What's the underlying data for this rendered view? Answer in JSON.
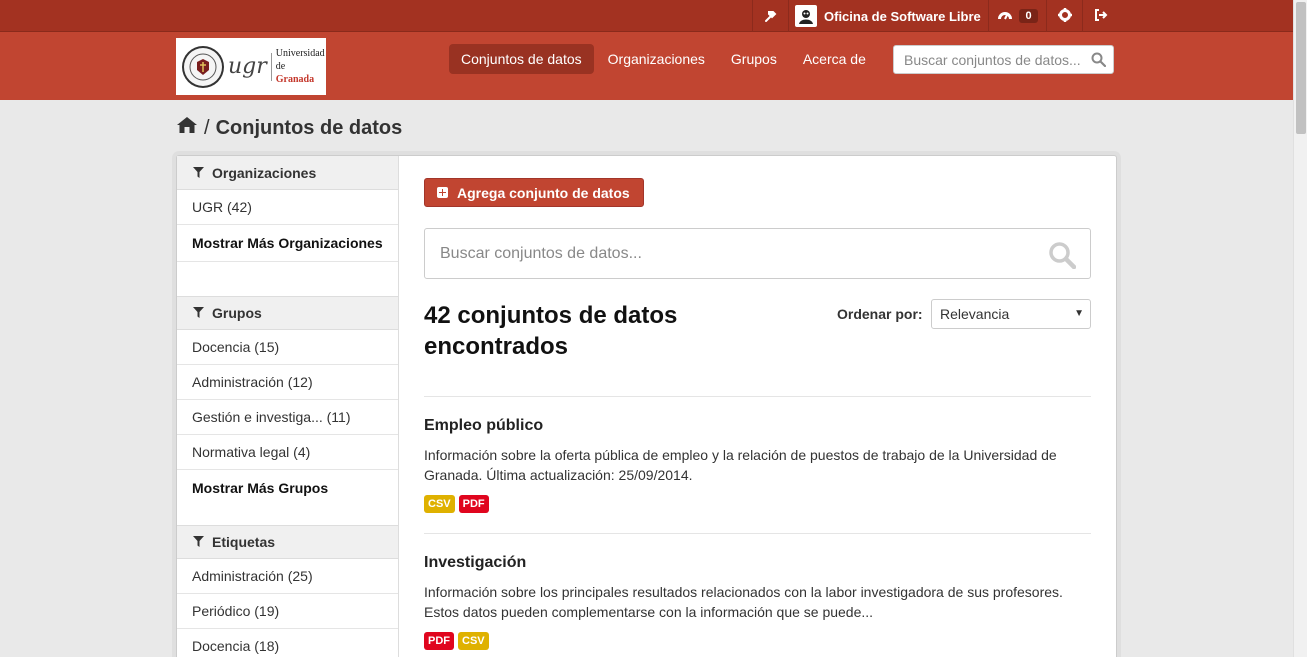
{
  "account": {
    "org_name": "Oficina de Software Libre",
    "activity_count": "0"
  },
  "brand": {
    "logo_abbr": "ugr",
    "logo_line1": "Universidad",
    "logo_line2_prefix": "de ",
    "logo_line2_accent": "Granada"
  },
  "nav": {
    "items": [
      {
        "label": "Conjuntos de datos",
        "active": true
      },
      {
        "label": "Organizaciones"
      },
      {
        "label": "Grupos"
      },
      {
        "label": "Acerca de"
      }
    ]
  },
  "header_search": {
    "placeholder": "Buscar conjuntos de datos..."
  },
  "breadcrumb": {
    "separator": "/",
    "current": "Conjuntos de datos"
  },
  "sidebar": {
    "organizaciones": {
      "title": "Organizaciones",
      "items": [
        "UGR (42)"
      ],
      "more": "Mostrar Más Organizaciones"
    },
    "grupos": {
      "title": "Grupos",
      "items": [
        "Docencia (15)",
        "Administración (12)",
        "Gestión e investiga... (11)",
        "Normativa legal (4)"
      ],
      "more": "Mostrar Más Grupos"
    },
    "etiquetas": {
      "title": "Etiquetas",
      "items": [
        "Administración (25)",
        "Periódico (19)",
        "Docencia (18)"
      ]
    }
  },
  "main": {
    "add_button": "Agrega conjunto de datos",
    "search_placeholder": "Buscar conjuntos de datos...",
    "count_text": "42 conjuntos de datos encontrados",
    "sort_label": "Ordenar por:",
    "sort_value": "Relevancia",
    "datasets": [
      {
        "title": "Empleo público",
        "notes": "Información sobre la oferta pública de empleo y la relación de puestos de trabajo de la Universidad de Granada. Última actualización: 25/09/2014.",
        "formats": [
          {
            "label": "CSV",
            "color": "#dfb100"
          },
          {
            "label": "PDF",
            "color": "#e0051e"
          }
        ]
      },
      {
        "title": "Investigación",
        "notes": "Información sobre los principales resultados relacionados con la labor investigadora de sus profesores. Estos datos pueden complementarse con la información que se puede...",
        "formats": [
          {
            "label": "PDF",
            "color": "#e0051e"
          },
          {
            "label": "CSV",
            "color": "#dfb100"
          }
        ]
      }
    ]
  },
  "colors": {
    "accent": "#c14531",
    "account_bar": "#a33221",
    "nav_active": "#993222"
  }
}
